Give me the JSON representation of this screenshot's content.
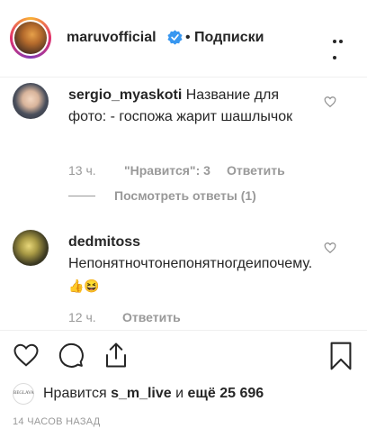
{
  "header": {
    "username": "maruvofficial",
    "separator": "•",
    "follow_label": "Подписки"
  },
  "comments": [
    {
      "username": "sergio_myaskoti",
      "text": "Название для фото: - госпожа жарит шашлычок",
      "time": "13 ч.",
      "likes": "\"Нравится\": 3",
      "reply_label": "Ответить",
      "view_replies": "Посмотреть ответы (1)"
    },
    {
      "username": "dedmitoss",
      "text": "Непонятночтонепонятногдеипочему.",
      "emoji": "👍😆",
      "time": "12 ч.",
      "reply_label": "Ответить"
    }
  ],
  "likes": {
    "avatar_text": "BEGLAVA",
    "prefix": "Нравится",
    "user": "s_m_live",
    "suffix_word": "и",
    "suffix": "ещё 25 696"
  },
  "timestamp": "14 ЧАСОВ НАЗАД",
  "icons": [
    "verified-badge-icon",
    "more-options-icon",
    "heart-icon",
    "comment-icon",
    "share-icon",
    "bookmark-icon"
  ],
  "colors": {
    "verified": "#3897f0",
    "muted": "#999999",
    "text": "#262626"
  }
}
